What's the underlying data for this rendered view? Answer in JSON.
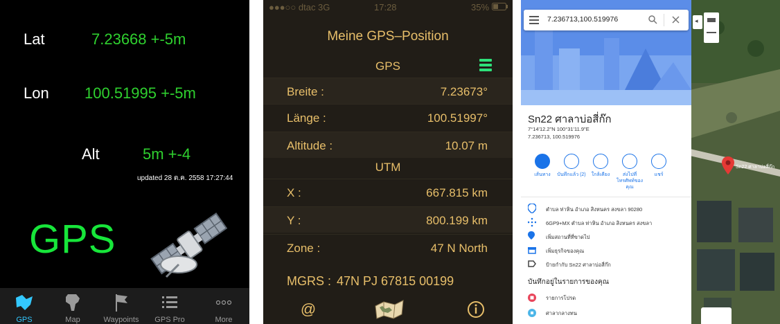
{
  "gps_app": {
    "lat_label": "Lat",
    "lat_value": "7.23668 +-5m",
    "lon_label": "Lon",
    "lon_value": "100.51995 +-5m",
    "alt_label": "Alt",
    "alt_value": "5m +-4",
    "updated": "updated 28 ต.ค. 2558 17:27:44",
    "big_label": "GPS",
    "tabs": [
      {
        "label": "GPS",
        "icon": "gps-globe-icon",
        "active": true
      },
      {
        "label": "Map",
        "icon": "africa-map-icon",
        "active": false
      },
      {
        "label": "Waypoints",
        "icon": "flag-icon",
        "active": false
      },
      {
        "label": "GPS Pro",
        "icon": "list-icon",
        "active": false
      },
      {
        "label": "More",
        "icon": "more-dots-icon",
        "active": false
      }
    ],
    "colors": {
      "background": "#000000",
      "value_green": "#2fd12f",
      "active_tab": "#33c8ff"
    }
  },
  "position_app": {
    "status_bar": {
      "carrier": "●●●○○ dtac  3G",
      "time": "17:28",
      "battery": "35%"
    },
    "title": "Meine GPS–Position",
    "gps_section": "GPS",
    "rows_gps": [
      {
        "key": "Breite :",
        "value": "7.23673°"
      },
      {
        "key": "Länge :",
        "value": "100.51997°"
      },
      {
        "key": "Altitude :",
        "value": "10.07 m"
      }
    ],
    "utm_section": "UTM",
    "rows_utm": [
      {
        "key": "X :",
        "value": "667.815 km"
      },
      {
        "key": "Y :",
        "value": "800.199 km"
      },
      {
        "key": "Zone :",
        "value": "47  N   North"
      }
    ],
    "mgrs_label": "MGRS :",
    "mgrs_value": "47N PJ 67815 00199",
    "bottom_icons": [
      "at-icon",
      "map-icon",
      "info-icon"
    ],
    "colors": {
      "background": "#211d17",
      "text": "#e8bf6a",
      "menu": "#2ee07a"
    }
  },
  "maps_app": {
    "search_query": "7.236713,100.519976",
    "place_title": "Sn22 ศาลาบ่อสี่ก๊ก",
    "dms": "7°14'12.2\"N 100°31'11.9\"E",
    "decimal": "7.236713, 100.519976",
    "actions": [
      {
        "label": "เส้นทาง",
        "icon": "directions-icon"
      },
      {
        "label": "บันทึกแล้ว\n(2)",
        "icon": "saved-icon"
      },
      {
        "label": "ใกล้เคียง",
        "icon": "nearby-icon"
      },
      {
        "label": "ส่งไปที่\nโทรศัพท์ของ\nคุณ",
        "icon": "send-to-phone-icon"
      },
      {
        "label": "แชร์",
        "icon": "share-icon"
      }
    ],
    "details": [
      {
        "icon": "location-pin-icon",
        "text": "ตำบล ท่าหิน อำเภอ สิงหนคร สงขลา 90280"
      },
      {
        "icon": "plus-code-icon",
        "text": "6GP9+MX ตำบล ท่าหิน อำเภอ สิงหนคร สงขลา"
      },
      {
        "icon": "add-place-icon",
        "text": "เพิ่มสถานที่ที่ขาดไป"
      },
      {
        "icon": "add-business-icon",
        "text": "เพิ่มธุรกิจของคุณ"
      },
      {
        "icon": "label-icon",
        "text": "ป้ายกำกับ  Sn22 ศาลาบ่อสี่ก๊ก"
      }
    ],
    "saved_section": "บันทึกอยู่ในรายการของคุณ",
    "saved_items": [
      {
        "icon": "heart-list-icon",
        "text": "รายการโปรด",
        "color": "#e8445a"
      },
      {
        "icon": "flag-list-icon",
        "text": "ศาลากลางทน",
        "color": "#4db6e8"
      }
    ],
    "pin_label": "Sn22 ศาลาบ่อสี่ก๊ก",
    "colors": {
      "accent": "#1a73e8",
      "pin": "#e53935"
    }
  }
}
